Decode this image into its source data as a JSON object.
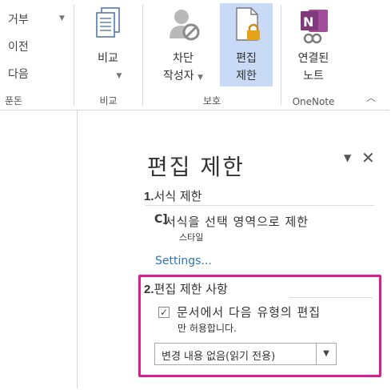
{
  "ribbon": {
    "review_group": {
      "items": [
        "거부",
        "이전",
        "다음"
      ],
      "label": "푼돈"
    },
    "compare_group": {
      "button": "비교",
      "label": "비교"
    },
    "protect_group": {
      "block_authors": [
        "차단",
        "작성자"
      ],
      "restrict_editing": [
        "편집",
        "제한"
      ],
      "label": "보호"
    },
    "onenote_group": {
      "linked_notes": [
        "연결된",
        "노트"
      ],
      "label": "OneNote"
    }
  },
  "pane": {
    "title": "편집 제한",
    "section1": {
      "number": "1.",
      "heading": "서식 제한",
      "bracket": "C]",
      "line1": "서식을 선택 영역으로 제한",
      "line2": "스타일",
      "settings_link": "Settings..."
    },
    "section2": {
      "number": "2.",
      "heading": "편집 제한 사항",
      "checkbox_checked": true,
      "line1": "문서에서 다음 유형의 편집",
      "line2": "만 허용합니다.",
      "dropdown_value": "변경 내용 없음(읽기 전용)"
    }
  },
  "colors": {
    "highlight_border": "#e01c8c",
    "active_button": "#c8daf5",
    "link": "#2e74b5",
    "onenote_purple": "#80397b"
  }
}
